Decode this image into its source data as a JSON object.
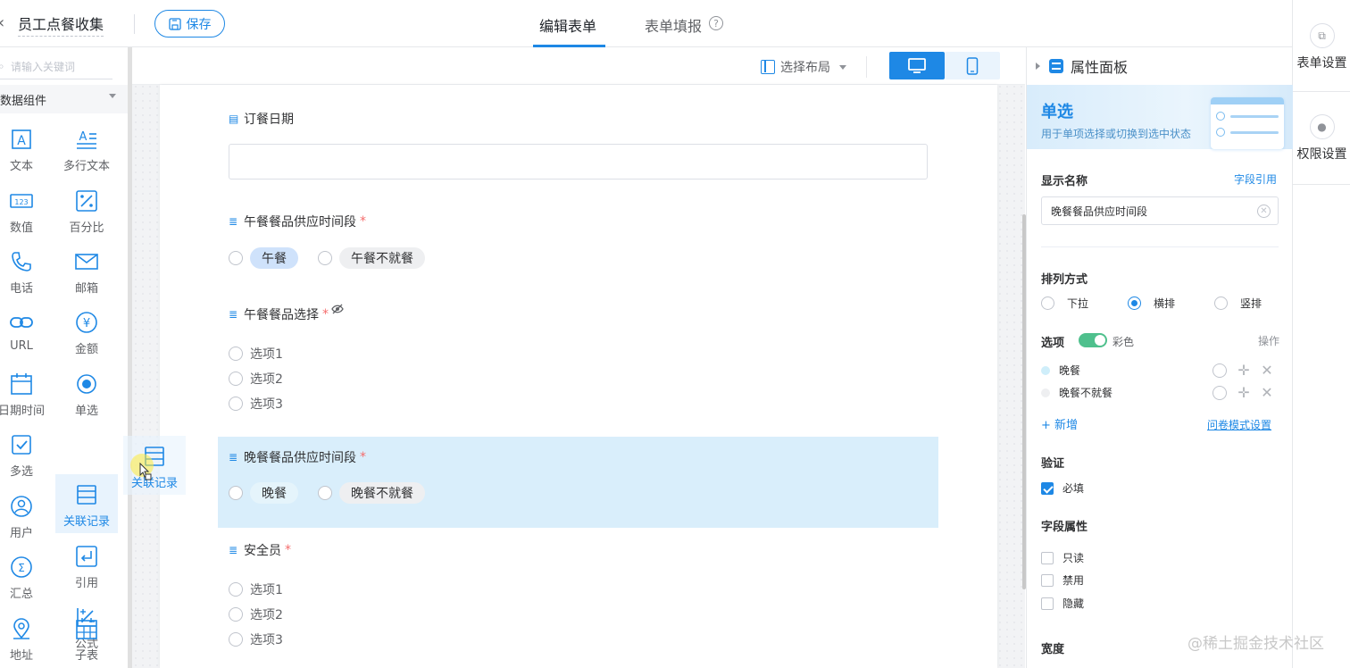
{
  "header": {
    "app_title": "员工点餐收集",
    "save_label": "保存",
    "tabs": [
      {
        "label": "编辑表单",
        "active": true
      },
      {
        "label": "表单填报",
        "active": false
      }
    ],
    "help_icon": "?"
  },
  "rail": {
    "items": [
      {
        "label": "表单设置",
        "icon": "form-settings-icon"
      },
      {
        "label": "权限设置",
        "icon": "shield-icon"
      }
    ]
  },
  "left_panel": {
    "search_placeholder": "请输入关键词",
    "group_label": "数据组件",
    "components": [
      {
        "label": "文本",
        "icon": "text-icon"
      },
      {
        "label": "多行文本",
        "icon": "multiline-text-icon"
      },
      {
        "label": "数值",
        "icon": "number-icon"
      },
      {
        "label": "百分比",
        "icon": "percent-icon"
      },
      {
        "label": "电话",
        "icon": "phone-icon"
      },
      {
        "label": "邮箱",
        "icon": "mail-icon"
      },
      {
        "label": "URL",
        "icon": "link-icon"
      },
      {
        "label": "金额",
        "icon": "yen-icon"
      },
      {
        "label": "日期时间",
        "icon": "calendar-icon"
      },
      {
        "label": "单选",
        "icon": "radio-icon"
      },
      {
        "label": "多选",
        "icon": "checkbox-icon"
      },
      {
        "label": "关联记录",
        "icon": "relation-icon"
      },
      {
        "label": "用户",
        "icon": "user-icon"
      },
      {
        "label": "引用",
        "icon": "reference-icon"
      },
      {
        "label": "汇总",
        "icon": "sigma-icon"
      },
      {
        "label": "公式",
        "icon": "formula-icon"
      },
      {
        "label": "地址",
        "icon": "location-icon"
      },
      {
        "label": "子表",
        "icon": "subtable-icon"
      }
    ],
    "drag_ghost_label": "关联记录"
  },
  "toolbar": {
    "layout_label": "选择布局"
  },
  "form": {
    "fields": [
      {
        "label": "订餐日期",
        "required": false,
        "type": "date"
      },
      {
        "label": "午餐餐品供应时间段",
        "required": true,
        "type": "radio-pill",
        "options": [
          "午餐",
          "午餐不就餐"
        ]
      },
      {
        "label": "午餐餐品选择",
        "required": true,
        "type": "radio",
        "options": [
          "选项1",
          "选项2",
          "选项3"
        ],
        "hidden": true
      },
      {
        "label": "晚餐餐品供应时间段",
        "required": true,
        "type": "radio-pill",
        "options": [
          "晚餐",
          "晚餐不就餐"
        ],
        "selected": true
      },
      {
        "label": "安全员",
        "required": true,
        "type": "radio",
        "options": [
          "选项1",
          "选项2",
          "选项3"
        ]
      }
    ],
    "required_mark": "*"
  },
  "props": {
    "title": "属性面板",
    "banner_title": "单选",
    "banner_desc": "用于单项选择或切换到选中状态",
    "display_name_label": "显示名称",
    "field_ref_link": "字段引用",
    "display_name_value": "晚餐餐品供应时间段",
    "arrange_label": "排列方式",
    "arrange_options": [
      {
        "label": "下拉",
        "checked": false
      },
      {
        "label": "横排",
        "checked": true
      },
      {
        "label": "竖排",
        "checked": false
      }
    ],
    "options_label": "选项",
    "color_label": "彩色",
    "ops_label": "操作",
    "option_items": [
      {
        "label": "晚餐",
        "color": "#cfeefa"
      },
      {
        "label": "晚餐不就餐",
        "color": "#eeeff1"
      }
    ],
    "add_label": "新增",
    "survey_link": "问卷模式设置",
    "validate_label": "验证",
    "required_label": "必填",
    "field_attr_label": "字段属性",
    "attr_items": [
      "只读",
      "禁用",
      "隐藏"
    ],
    "width_label": "宽度"
  },
  "watermark": "@稀土掘金技术社区",
  "colors": {
    "accent": "#1e88e5",
    "selected_block": "#d9eefb",
    "toggle_on": "#4fc08d"
  }
}
